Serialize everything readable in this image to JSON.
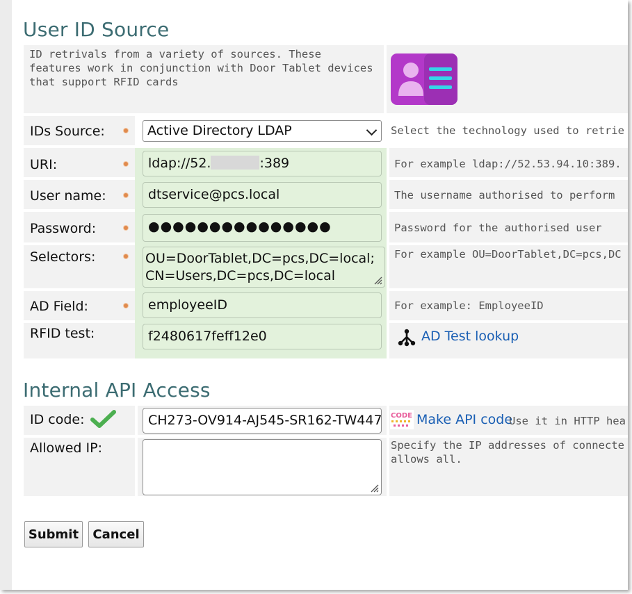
{
  "user_id_section": {
    "title": "User ID Source",
    "description": [
      "ID retrivals from a variety of sources.  These",
      "features work in conjunction with Door Tablet devices",
      "that support RFID cards"
    ],
    "icon": "id-card-icon"
  },
  "fields": {
    "ids_source": {
      "label": "IDs Source:",
      "value": "Active Directory LDAP",
      "help": "Select the technology used to retrie"
    },
    "uri": {
      "label": "URI:",
      "value_prefix": "ldap://52.",
      "value_suffix": ":389",
      "help": "For example ldap://52.53.94.10:389."
    },
    "username": {
      "label": "User name:",
      "value": "dtservice@pcs.local",
      "help": "The username authorised to perform "
    },
    "password": {
      "label": "Password:",
      "value": "●●●●●●●●●●●●●●●",
      "help": "Password for the authorised user"
    },
    "selectors": {
      "label": "Selectors:",
      "line1": "OU=DoorTablet,DC=pcs,DC=local;",
      "line2": "CN=Users,DC=pcs,DC=local",
      "help": "For example OU=DoorTablet,DC=pcs,DC"
    },
    "ad_field": {
      "label": "AD Field:",
      "value": "employeeID",
      "help": "For example: EmployeeID"
    },
    "rfid_test": {
      "label": "RFID test:",
      "value": "f2480617feff12e0",
      "link": "AD Test lookup",
      "link_icon": "network-tree-icon"
    }
  },
  "api_section": {
    "title": "Internal API Access",
    "id_code": {
      "label": "ID code:",
      "value": "CH273-OV914-AJ545-SR162-TW447",
      "status_icon": "checkmark-icon",
      "link": "Make API code",
      "link_icon": "code-badge-icon",
      "help": "Use it in HTTP hea"
    },
    "allowed_ip": {
      "label": "Allowed IP:",
      "value": "",
      "help_line1": "Specify the IP addresses of connecte",
      "help_line2": "allows all."
    }
  },
  "buttons": {
    "submit": "Submit",
    "cancel": "Cancel"
  },
  "colors": {
    "heading": "#3c6c72",
    "green_field": "#e3f2dc",
    "required_dot": "#e08a4d",
    "link": "#1a5fb4",
    "check": "#4caf50"
  }
}
